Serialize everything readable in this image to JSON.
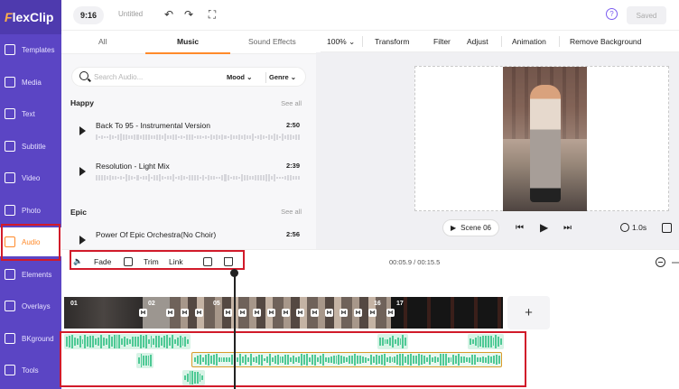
{
  "brand": {
    "logo_prefix": "F",
    "logo_rest": "lexClip",
    "accent_color": "#ff8a2a",
    "sidebar_color": "#5b45c4"
  },
  "sidebar": {
    "items": [
      {
        "label": "Templates",
        "icon": "templates-icon",
        "active": false
      },
      {
        "label": "Media",
        "icon": "media-icon",
        "active": false
      },
      {
        "label": "Text",
        "icon": "text-icon",
        "active": false
      },
      {
        "label": "Subtitle",
        "icon": "subtitle-icon",
        "active": false
      },
      {
        "label": "Video",
        "icon": "video-icon",
        "active": false
      },
      {
        "label": "Photo",
        "icon": "photo-icon",
        "active": false
      },
      {
        "label": "Audio",
        "icon": "music-note-icon",
        "active": true
      },
      {
        "label": "Elements",
        "icon": "elements-icon",
        "active": false
      },
      {
        "label": "Overlays",
        "icon": "overlays-icon",
        "active": false
      },
      {
        "label": "BKground",
        "icon": "background-icon",
        "active": false
      },
      {
        "label": "Tools",
        "icon": "tools-icon",
        "active": false
      }
    ]
  },
  "topbar": {
    "ratio": "9:16",
    "title": "Untitled",
    "saved_label": "Saved",
    "help": "?"
  },
  "panel": {
    "tabs": [
      {
        "label": "All",
        "active": false
      },
      {
        "label": "Music",
        "active": true
      },
      {
        "label": "Sound Effects",
        "active": false
      }
    ],
    "search": {
      "placeholder": "Search Audio...",
      "value": ""
    },
    "filters": {
      "mood": "Mood",
      "genre": "Genre"
    },
    "sections": [
      {
        "title": "Happy",
        "see_all": "See all",
        "tracks": [
          {
            "name": "Back To 95 - Instrumental Version",
            "duration": "2:50"
          },
          {
            "name": "Resolution - Light Mix",
            "duration": "2:39"
          }
        ]
      },
      {
        "title": "Epic",
        "see_all": "See all",
        "tracks": [
          {
            "name": "Power Of Epic Orchestra(No Choir)",
            "duration": "2:56"
          }
        ]
      }
    ]
  },
  "edit_toolbar": {
    "zoom": "100%",
    "transform": "Transform",
    "filter": "Filter",
    "adjust": "Adjust",
    "animation": "Animation",
    "remove_bg": "Remove Background"
  },
  "preview": {
    "scene_label": "Scene 06",
    "duration": "1.0s"
  },
  "timeline_toolbar": {
    "fade": "Fade",
    "trim": "Trim",
    "link": "Link",
    "time": "00:05.9 / 00:15.5"
  },
  "timeline": {
    "scene_numbers": [
      "01",
      "02",
      "05",
      "16",
      "17"
    ],
    "add_label": "+"
  }
}
